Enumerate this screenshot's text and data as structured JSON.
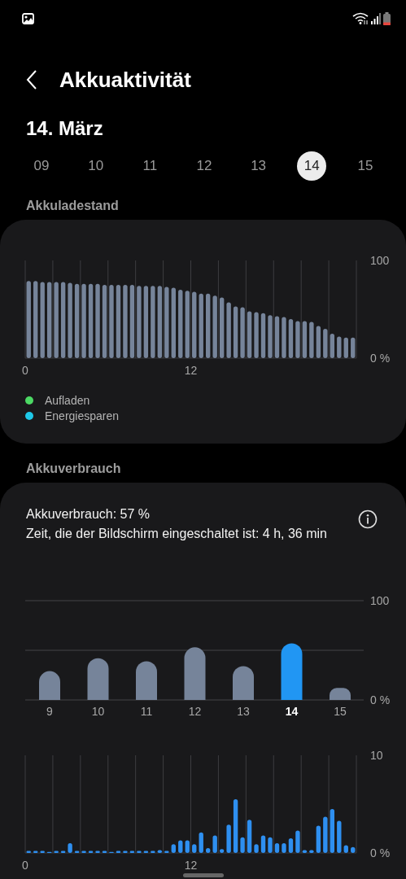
{
  "header": {
    "title": "Akkuaktivität"
  },
  "date_title": "14. März",
  "days": [
    {
      "label": "09",
      "selected": false
    },
    {
      "label": "10",
      "selected": false
    },
    {
      "label": "11",
      "selected": false
    },
    {
      "label": "12",
      "selected": false
    },
    {
      "label": "13",
      "selected": false
    },
    {
      "label": "14",
      "selected": true
    },
    {
      "label": "15",
      "selected": false
    }
  ],
  "battery_level": {
    "title": "Akkuladestand",
    "chart_data": {
      "type": "bar",
      "xlim": [
        0,
        24
      ],
      "ylim": [
        0,
        100
      ],
      "x": [
        0.25,
        0.75,
        1.25,
        1.75,
        2.25,
        2.75,
        3.25,
        3.75,
        4.25,
        4.75,
        5.25,
        5.75,
        6.25,
        6.75,
        7.25,
        7.75,
        8.25,
        8.75,
        9.25,
        9.75,
        10.25,
        10.75,
        11.25,
        11.75,
        12.25,
        12.75,
        13.25,
        13.75,
        14.25,
        14.75,
        15.25,
        15.75,
        16.25,
        16.75,
        17.25,
        17.75,
        18.25,
        18.75,
        19.25,
        19.75,
        20.25,
        20.75,
        21.25,
        21.75,
        22.25,
        22.75,
        23.25,
        23.75
      ],
      "xticks": [
        {
          "value": 0,
          "label": "0"
        },
        {
          "value": 12,
          "label": "12"
        }
      ],
      "yticks": [
        {
          "value": 0,
          "label": "0 %"
        },
        {
          "value": 100,
          "label": "100"
        }
      ],
      "series": [
        {
          "color": "#76849a",
          "values": [
            79,
            79,
            78,
            78,
            78,
            78,
            77,
            76,
            76,
            76,
            76,
            75,
            75,
            75,
            75,
            75,
            74,
            74,
            74,
            74,
            73,
            72,
            70,
            69,
            68,
            66,
            66,
            64,
            62,
            57,
            53,
            52,
            48,
            47,
            46,
            44,
            43,
            42,
            40,
            38,
            38,
            37,
            33,
            30,
            25,
            22,
            21,
            21
          ]
        }
      ]
    },
    "legend": [
      {
        "label": "Aufladen",
        "color": "#4cd964"
      },
      {
        "label": "Energiesparen",
        "color": "#1ec8e8"
      }
    ]
  },
  "battery_usage": {
    "title": "Akkuverbrauch",
    "summary": [
      "Akkuverbrauch: 57 %",
      "Zeit, die der Bildschirm eingeschaltet ist: 4 h, 36 min"
    ],
    "daily_chart": {
      "chart_data": {
        "type": "bar",
        "ylim": [
          0,
          100
        ],
        "categories": [
          "9",
          "10",
          "11",
          "12",
          "13",
          "14",
          "15"
        ],
        "yticks": [
          {
            "value": 0,
            "label": "0 %"
          },
          {
            "value": 100,
            "label": "100"
          }
        ],
        "ref_lines": [
          {
            "axis": "y",
            "value": 50
          }
        ],
        "series": [
          {
            "color": "#76849a",
            "values": [
              29,
              42,
              39,
              53,
              34,
              null,
              12
            ]
          },
          {
            "color": "#2196f3",
            "values": [
              null,
              null,
              null,
              null,
              null,
              57,
              null
            ]
          }
        ]
      }
    },
    "hourly_chart": {
      "chart_data": {
        "type": "bar",
        "xlim": [
          0,
          24
        ],
        "ylim": [
          0,
          10
        ],
        "x": [
          0.25,
          0.75,
          1.25,
          1.75,
          2.25,
          2.75,
          3.25,
          3.75,
          4.25,
          4.75,
          5.25,
          5.75,
          6.25,
          6.75,
          7.25,
          7.75,
          8.25,
          8.75,
          9.25,
          9.75,
          10.25,
          10.75,
          11.25,
          11.75,
          12.25,
          12.75,
          13.25,
          13.75,
          14.25,
          14.75,
          15.25,
          15.75,
          16.25,
          16.75,
          17.25,
          17.75,
          18.25,
          18.75,
          19.25,
          19.75,
          20.25,
          20.75,
          21.25,
          21.75,
          22.25,
          22.75,
          23.25,
          23.75
        ],
        "xticks": [
          {
            "value": 0,
            "label": "0"
          },
          {
            "value": 12,
            "label": "12"
          }
        ],
        "yticks": [
          {
            "value": 0,
            "label": "0 %"
          },
          {
            "value": 10,
            "label": "10"
          }
        ],
        "series": [
          {
            "color": "#2e8ff0",
            "values": [
              0.2,
              0.2,
              0.2,
              0.1,
              0.2,
              0.2,
              1.0,
              0.2,
              0.2,
              0.2,
              0.2,
              0.2,
              0.1,
              0.2,
              0.2,
              0.2,
              0.2,
              0.2,
              0.2,
              0.3,
              0.2,
              0.9,
              1.3,
              1.3,
              0.9,
              2.1,
              0.5,
              1.8,
              0.4,
              2.9,
              5.5,
              1.6,
              3.4,
              0.9,
              1.8,
              1.6,
              1.0,
              1.0,
              1.5,
              2.3,
              0.3,
              0.3,
              2.8,
              3.7,
              4.5,
              3.3,
              0.8,
              0.6
            ]
          }
        ]
      }
    }
  }
}
